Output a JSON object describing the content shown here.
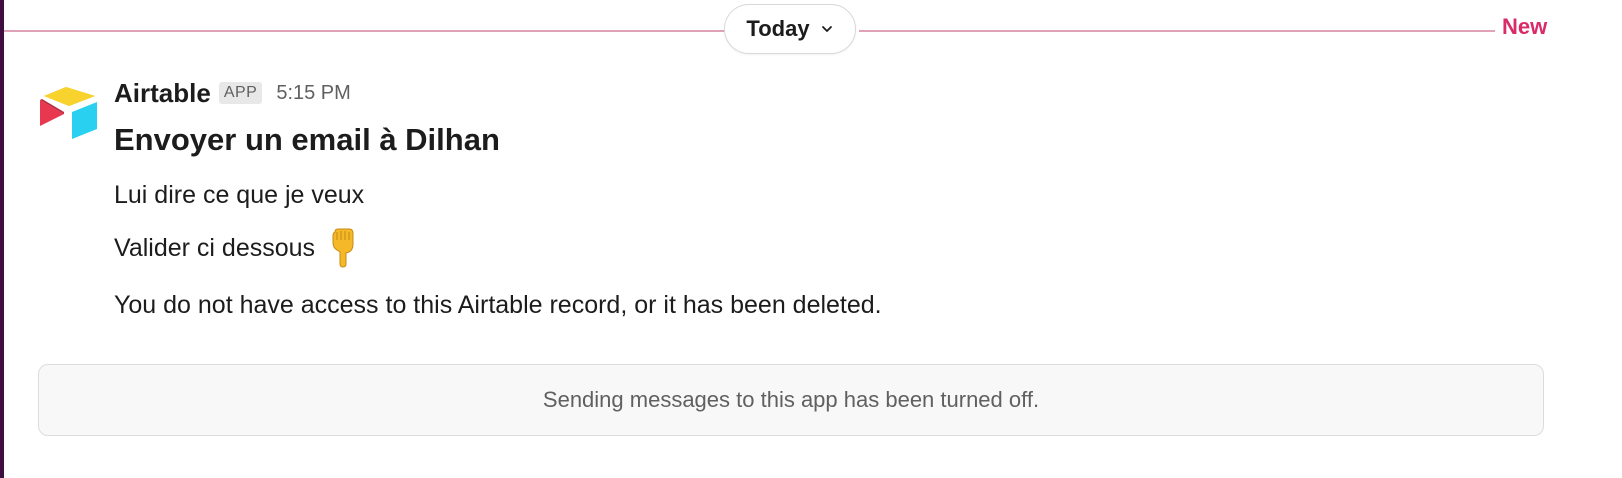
{
  "divider": {
    "day_label": "Today",
    "new_label": "New",
    "line_color": "#e0a2b8",
    "new_color": "#d92b6a"
  },
  "message": {
    "sender": "Airtable",
    "badge": "APP",
    "time": "5:15 PM",
    "title": "Envoyer un email à Dilhan",
    "lines": [
      "Lui dire ce que je veux",
      "Valider ci dessous",
      "You do not have access to this Airtable record, or it has been deleted."
    ],
    "emoji": "pointing-down-hand-icon"
  },
  "notice": {
    "text": "Sending messages to this app has been turned off."
  }
}
